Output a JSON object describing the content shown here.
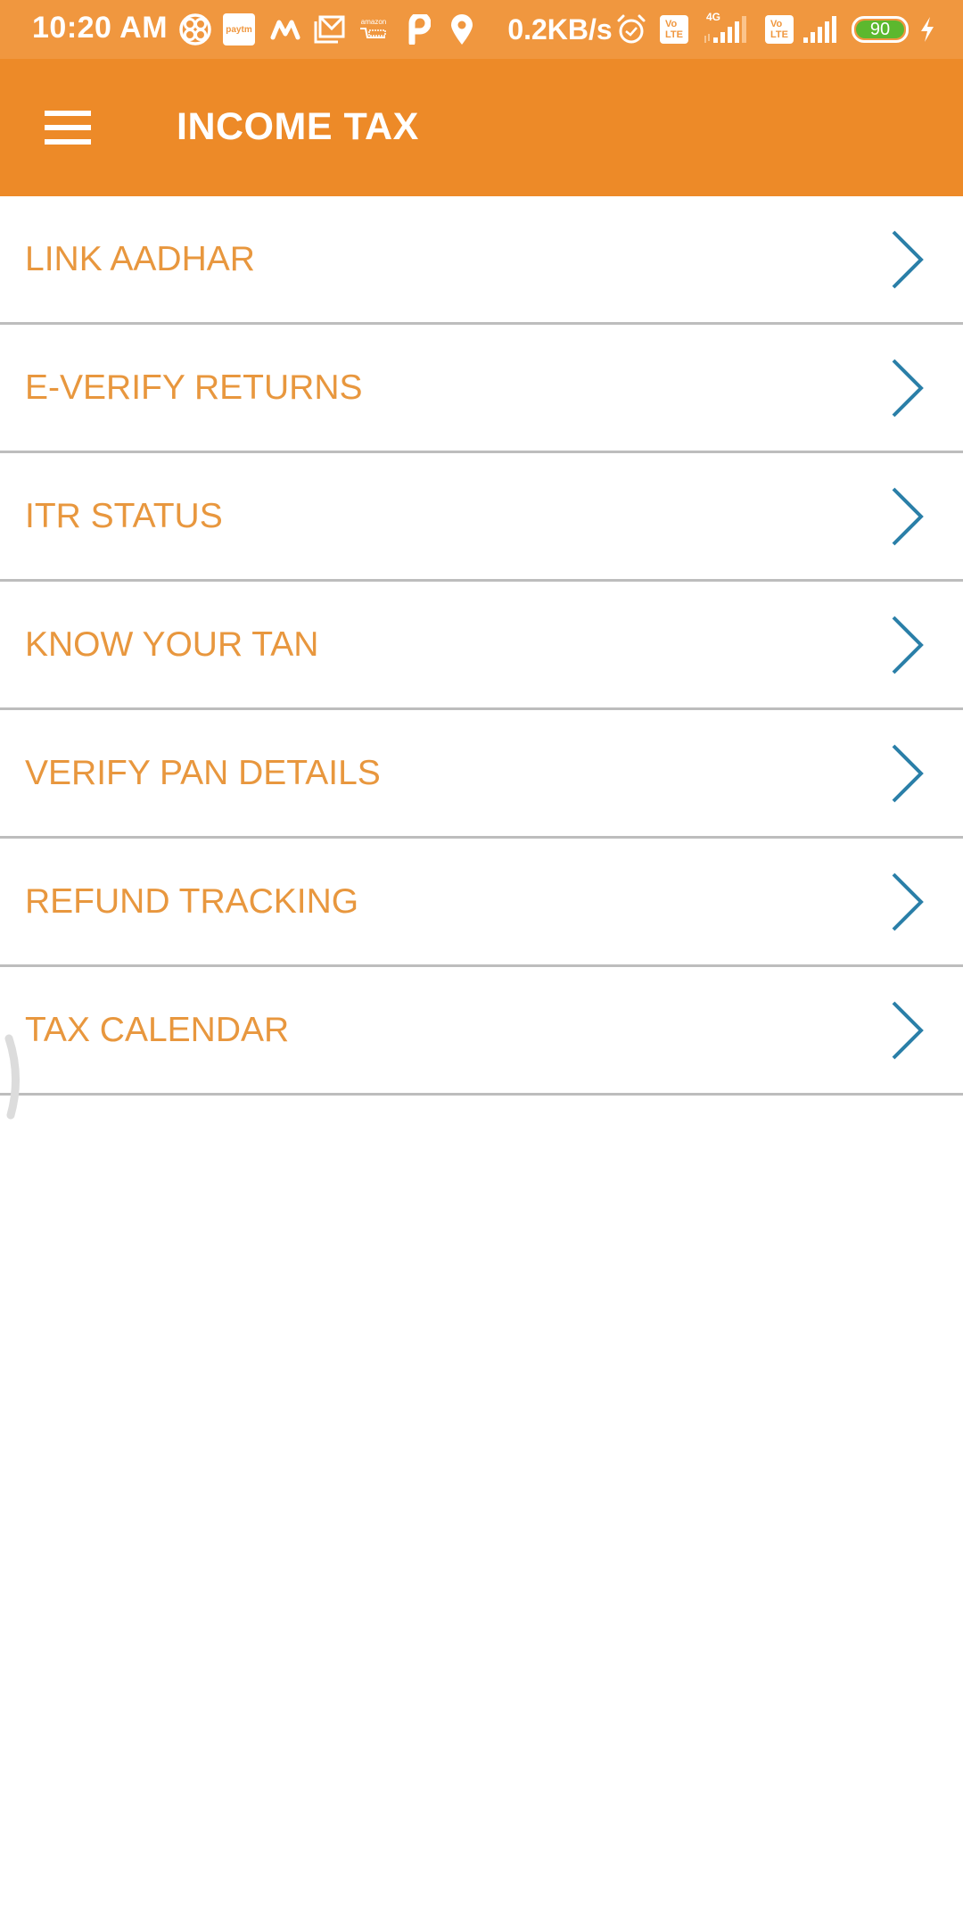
{
  "status_bar": {
    "time": "10:20 AM",
    "notification_icons": [
      "pinwheel-app-icon",
      "paytm-icon",
      "myntra-icon",
      "gmail-icon",
      "amazon-icon",
      "p-app-icon",
      "location-pin-icon"
    ],
    "paytm_label": "paytm",
    "amazon_label": "amazon",
    "network_speed": "0.2KB/s",
    "sim1_badge": "Vo LTE",
    "sim1_network": "4G",
    "sim2_badge": "Vo LTE",
    "battery_level": "90",
    "charging": true
  },
  "app_bar": {
    "title": "INCOME TAX",
    "menu_icon": "hamburger-menu-icon"
  },
  "menu": {
    "items": [
      {
        "label": "LINK AADHAR"
      },
      {
        "label": "E-VERIFY RETURNS"
      },
      {
        "label": "ITR STATUS"
      },
      {
        "label": "KNOW YOUR TAN"
      },
      {
        "label": "VERIFY PAN DETAILS"
      },
      {
        "label": "REFUND TRACKING"
      },
      {
        "label": "TAX CALENDAR"
      }
    ]
  },
  "colors": {
    "status_bar": "#f0973f",
    "app_bar": "#ed8a28",
    "item_label": "#e8973e",
    "chevron": "#2a7fa8",
    "divider": "#bdbdbd"
  }
}
